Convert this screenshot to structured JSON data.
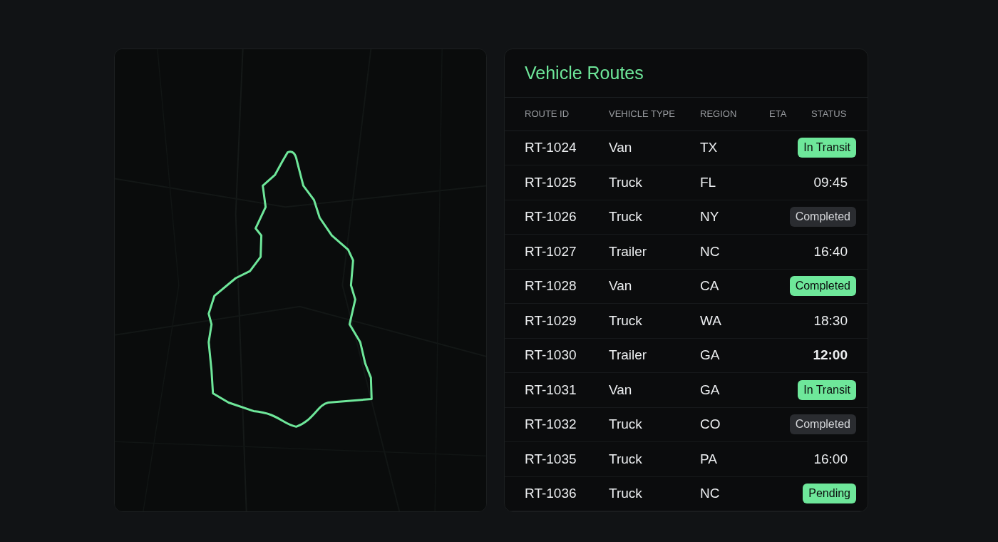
{
  "panel": {
    "title": "Vehicle Routes"
  },
  "table": {
    "columns": [
      "ROUTE ID",
      "VEHICLE TYPE",
      "REGION",
      "ETA",
      "STATUS"
    ],
    "rows": [
      {
        "route_id": "RT-1024",
        "vehicle_type": "Van",
        "region": "TX",
        "trailing": {
          "kind": "status",
          "text": "In Transit",
          "color": "#6ee79a"
        }
      },
      {
        "route_id": "RT-1025",
        "vehicle_type": "Truck",
        "region": "FL",
        "trailing": {
          "kind": "time",
          "text": "09:45",
          "bold": false
        }
      },
      {
        "route_id": "RT-1026",
        "vehicle_type": "Truck",
        "region": "NY",
        "trailing": {
          "kind": "status",
          "text": "Completed",
          "color": "#2a2c30"
        }
      },
      {
        "route_id": "RT-1027",
        "vehicle_type": "Trailer",
        "region": "NC",
        "trailing": {
          "kind": "time",
          "text": "16:40",
          "bold": false
        }
      },
      {
        "route_id": "RT-1028",
        "vehicle_type": "Van",
        "region": "CA",
        "trailing": {
          "kind": "status",
          "text": "Completed",
          "color": "#6ee79a"
        }
      },
      {
        "route_id": "RT-1029",
        "vehicle_type": "Truck",
        "region": "WA",
        "trailing": {
          "kind": "time",
          "text": "18:30",
          "bold": false
        }
      },
      {
        "route_id": "RT-1030",
        "vehicle_type": "Trailer",
        "region": "GA",
        "trailing": {
          "kind": "time",
          "text": "12:00",
          "bold": true
        }
      },
      {
        "route_id": "RT-1031",
        "vehicle_type": "Van",
        "region": "GA",
        "trailing": {
          "kind": "status",
          "text": "In Transit",
          "color": "#6ee79a"
        }
      },
      {
        "route_id": "RT-1032",
        "vehicle_type": "Truck",
        "region": "CO",
        "trailing": {
          "kind": "status",
          "text": "Completed",
          "color": "#2a2c30"
        }
      },
      {
        "route_id": "RT-1035",
        "vehicle_type": "Truck",
        "region": "PA",
        "trailing": {
          "kind": "time",
          "text": "16:00",
          "bold": false
        }
      },
      {
        "route_id": "RT-1036",
        "vehicle_type": "Truck",
        "region": "NC",
        "trailing": {
          "kind": "status",
          "text": "Pending",
          "color": "#6ee79a"
        }
      }
    ]
  }
}
